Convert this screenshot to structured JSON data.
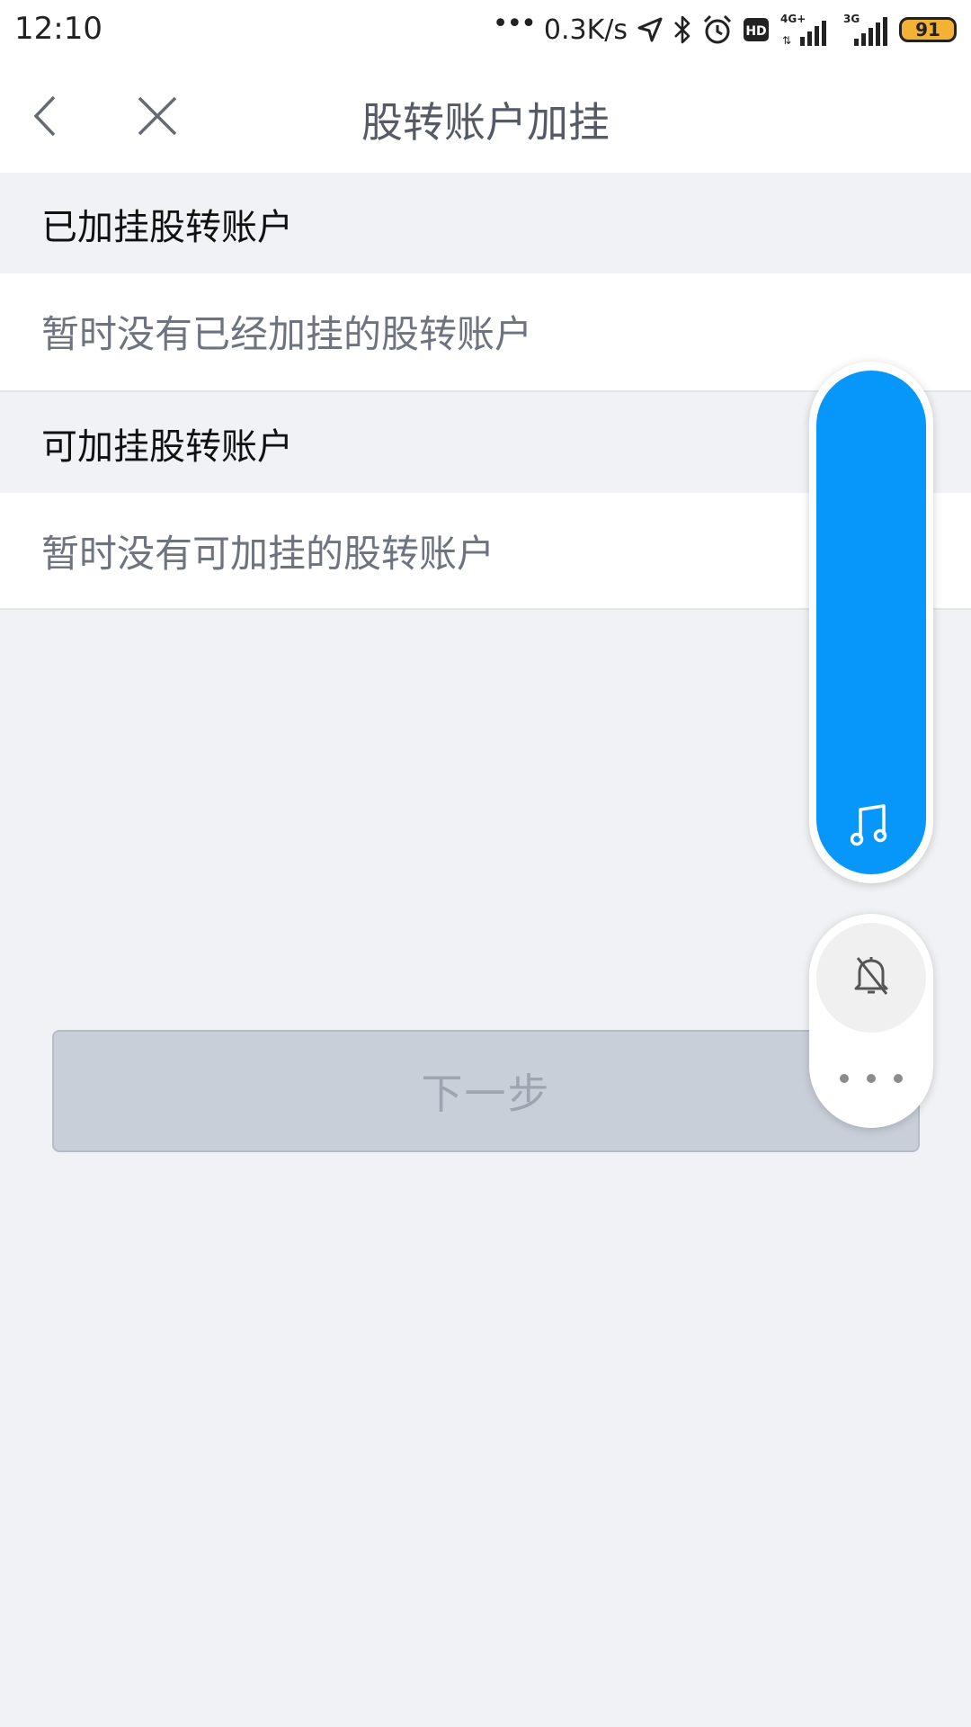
{
  "status_bar": {
    "time": "12:10",
    "network_speed": "0.3K/s",
    "signal_1_label": "4G+",
    "signal_2_label": "3G",
    "battery": "91"
  },
  "nav": {
    "title": "股转账户加挂"
  },
  "linked_section": {
    "header": "已加挂股转账户",
    "empty_text": "暂时没有已经加挂的股转账户"
  },
  "available_section": {
    "header": "可加挂股转账户",
    "empty_text": "暂时没有可加挂的股转账户"
  },
  "next_button": {
    "label": "下一步",
    "enabled": false
  },
  "volume_panel": {
    "level": 1.0,
    "color": "#0797fb",
    "icon": "music-note-icon"
  },
  "controls": {
    "bell_icon": "bell-off-icon",
    "more_icon": "more-icon"
  }
}
